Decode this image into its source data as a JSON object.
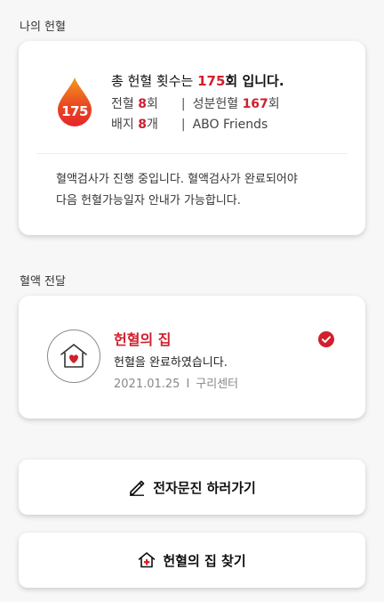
{
  "my_donation": {
    "section_label": "나의 헌혈",
    "drop_count": "175",
    "title_prefix": "총 헌혈 횟수는 ",
    "title_count": "175",
    "title_suffix": "회 입니다.",
    "whole_label": "전혈 ",
    "whole_count": "8",
    "whole_unit": "회",
    "separator": "|",
    "component_label": "성분헌혈 ",
    "component_count": "167",
    "component_unit": "회",
    "badge_label": "배지 ",
    "badge_count": "8",
    "badge_unit": "개",
    "group_name": "ABO Friends",
    "notice_line1": "혈액검사가 진행 중입니다. 혈액검사가 완료되어야",
    "notice_line2": "다음 헌혈가능일자 안내가 가능합니다."
  },
  "blood_transfer": {
    "section_label": "혈액 전달",
    "title": "헌혈의 집",
    "status": "헌혈을 완료하였습니다.",
    "date": "2021.01.25",
    "separator": "I",
    "center": "구리센터"
  },
  "actions": {
    "survey_label": "전자문진 하러가기",
    "find_label": "헌혈의 집 찾기"
  },
  "icons": {
    "drop": "blood-drop-icon",
    "home": "home-heart-icon",
    "check": "check-circle-icon",
    "pencil": "pencil-icon",
    "house_plus": "house-cross-icon"
  },
  "colors": {
    "accent": "#d0202e",
    "drop_top": "#f39a1e",
    "drop_bottom": "#e5262b"
  }
}
